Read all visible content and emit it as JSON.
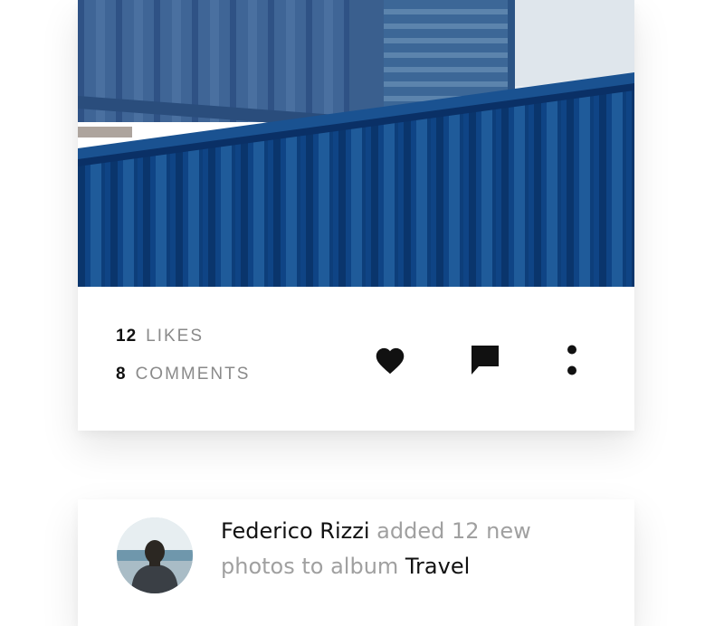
{
  "post": {
    "likes_count": "12",
    "likes_label": "LIKES",
    "comments_count": "8",
    "comments_label": "COMMENTS",
    "icons": {
      "like": "heart-icon",
      "comment": "speech-bubble-icon",
      "more": "more-vertical-icon"
    }
  },
  "activity": {
    "user_name": "Federico Rizzi",
    "action_text": "added 12 new photos to album",
    "album_name": "Travel"
  }
}
